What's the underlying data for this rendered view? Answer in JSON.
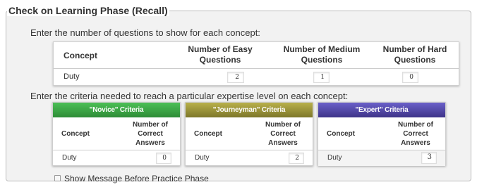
{
  "fieldset": {
    "legend": "Check on Learning Phase (Recall)",
    "instruction_questions": "Enter the number of questions to show for each concept:",
    "instruction_criteria": "Enter the criteria needed to reach a particular expertise level on each concept:"
  },
  "questions_table": {
    "headers": {
      "concept": "Concept",
      "easy_line1": "Number of Easy",
      "easy_line2": "Questions",
      "medium_line1": "Number of Medium",
      "medium_line2": "Questions",
      "hard_line1": "Number of Hard",
      "hard_line2": "Questions"
    },
    "rows": [
      {
        "concept": "Duty",
        "easy": "2",
        "medium": "1",
        "hard": "0"
      }
    ]
  },
  "criteria_tables": [
    {
      "title": "\"Novice\" Criteria",
      "color": "#3aa845",
      "col_concept": "Concept",
      "col_answers_1": "Number of",
      "col_answers_2": "Correct",
      "col_answers_3": "Answers",
      "row_concept": "Duty",
      "row_value": "0"
    },
    {
      "title": "\"Journeyman\" Criteria",
      "color": "#9a933a",
      "col_concept": "Concept",
      "col_answers_1": "Number of",
      "col_answers_2": "Correct",
      "col_answers_3": "Answers",
      "row_concept": "Duty",
      "row_value": "2"
    },
    {
      "title": "\"Expert\" Criteria",
      "color": "#4f45a8",
      "col_concept": "Concept",
      "col_answers_1": "Number of",
      "col_answers_2": "Correct",
      "col_answers_3": "Answers",
      "row_concept": "Duty",
      "row_value": "3"
    }
  ],
  "options": {
    "show_message_label": "Show Message Before Practice Phase",
    "show_message_checked": false
  }
}
